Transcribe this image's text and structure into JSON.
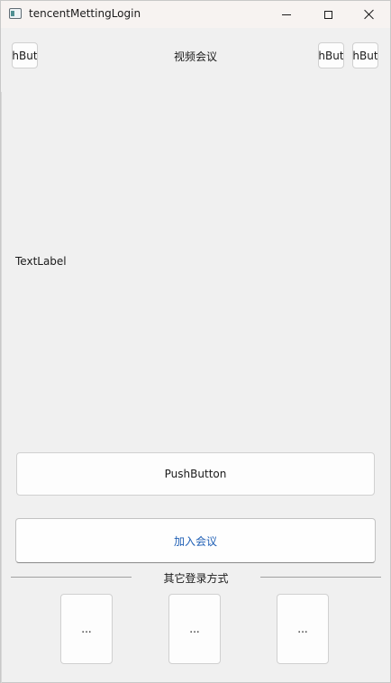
{
  "window": {
    "title": "tencentMettingLogin",
    "icon": "app-window-icon"
  },
  "controls": {
    "minimize_icon": "minimize-icon",
    "maximize_icon": "maximize-icon",
    "close_icon": "close-icon"
  },
  "header": {
    "left_button": "hBut",
    "title": "视频会议",
    "right_button_1": "hBut",
    "right_button_2": "hBut"
  },
  "content": {
    "text_label": "TextLabel",
    "push_button": "PushButton",
    "join_button": "加入会议"
  },
  "other_login": {
    "label": "其它登录方式",
    "options": [
      "...",
      "...",
      "..."
    ]
  },
  "colors": {
    "background": "#f0f0f0",
    "titlebar": "#f7f3f1",
    "join_text": "#1f5fb5"
  }
}
